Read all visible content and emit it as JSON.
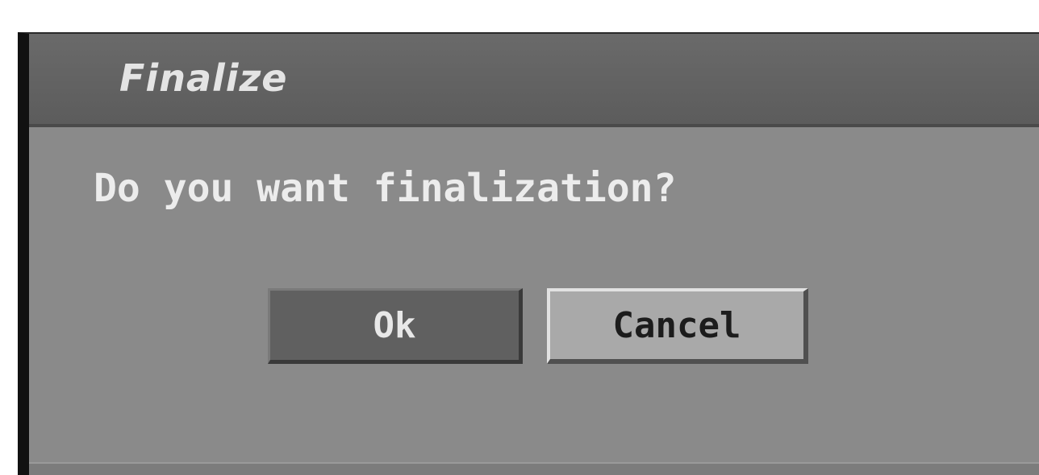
{
  "dialog": {
    "title": "Finalize",
    "message": "Do you want finalization?",
    "buttons": {
      "ok_label": "Ok",
      "cancel_label": "Cancel"
    },
    "focused_button": "Cancel"
  },
  "colors": {
    "panel": "#8a8a8a",
    "title_bar": "#626262",
    "ok_button": "#606060",
    "cancel_button_focused": "#a9a9a9",
    "text_light": "#ececec",
    "text_dark": "#1c1c1c"
  }
}
